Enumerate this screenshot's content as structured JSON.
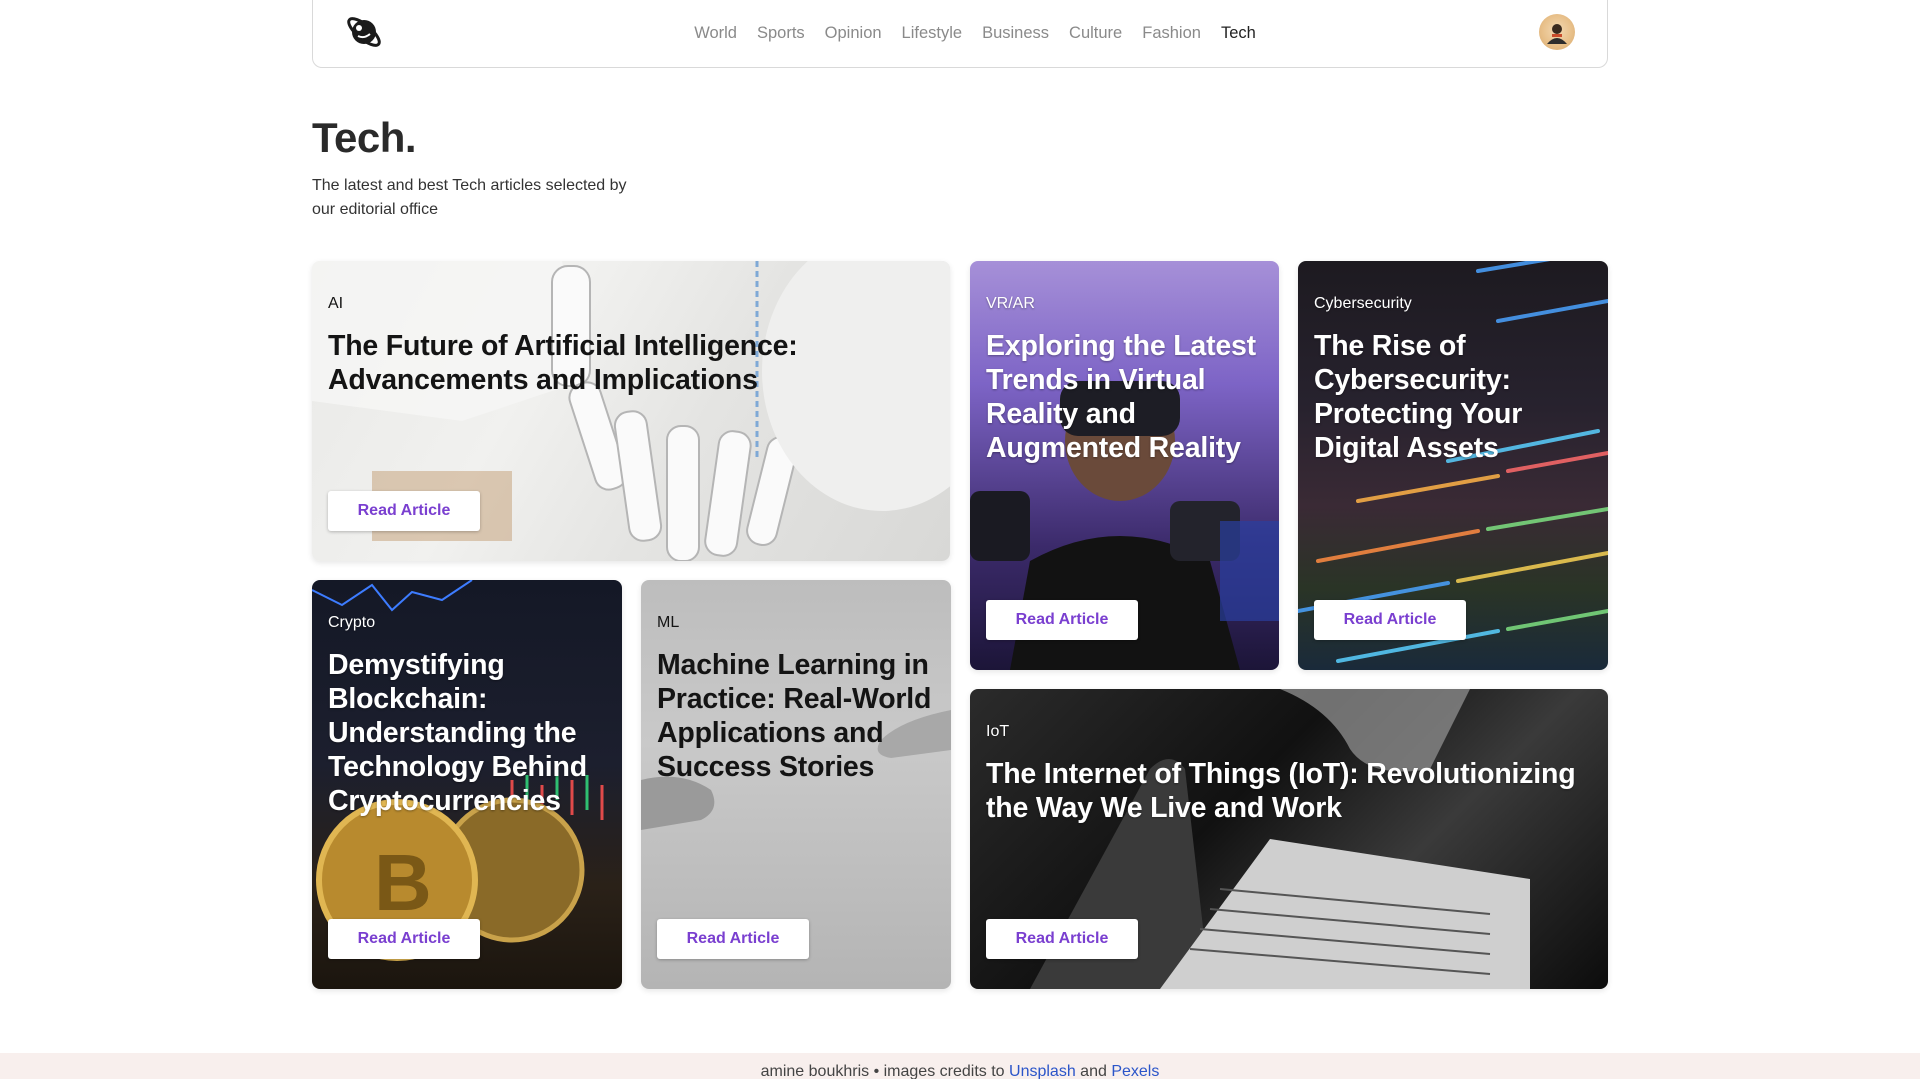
{
  "nav": {
    "links": [
      "World",
      "Sports",
      "Opinion",
      "Lifestyle",
      "Business",
      "Culture",
      "Fashion",
      "Tech"
    ],
    "active": "Tech"
  },
  "hero": {
    "title": "Tech.",
    "subtitle": "The latest and best Tech articles selected by our editorial office"
  },
  "cards": [
    {
      "tag": "AI",
      "title": "The Future of Artificial Intelligence: Advancements and Implications",
      "button": "Read Article"
    },
    {
      "tag": "VR/AR",
      "title": "Exploring the Latest Trends in Virtual Reality and Augmented Reality",
      "button": "Read Article"
    },
    {
      "tag": "Cybersecurity",
      "title": "The Rise of Cybersecurity: Protecting Your Digital Assets",
      "button": "Read Article"
    },
    {
      "tag": "Crypto",
      "title": "Demystifying Blockchain: Understanding the Technology Behind Cryptocurrencies",
      "button": "Read Article"
    },
    {
      "tag": "ML",
      "title": "Machine Learning in Practice: Real-World Applications and Success Stories",
      "button": "Read Article"
    },
    {
      "tag": "IoT",
      "title": "The Internet of Things (IoT): Revolutionizing the Way We Live and Work",
      "button": "Read Article"
    }
  ],
  "footer": {
    "prefix": "amine boukhris • images credits to",
    "link1": "Unsplash",
    "and": "and",
    "link2": "Pexels"
  },
  "colors": {
    "accent": "#7a3fd0",
    "link": "#2b55c9",
    "footer_bg": "#f8efed"
  }
}
